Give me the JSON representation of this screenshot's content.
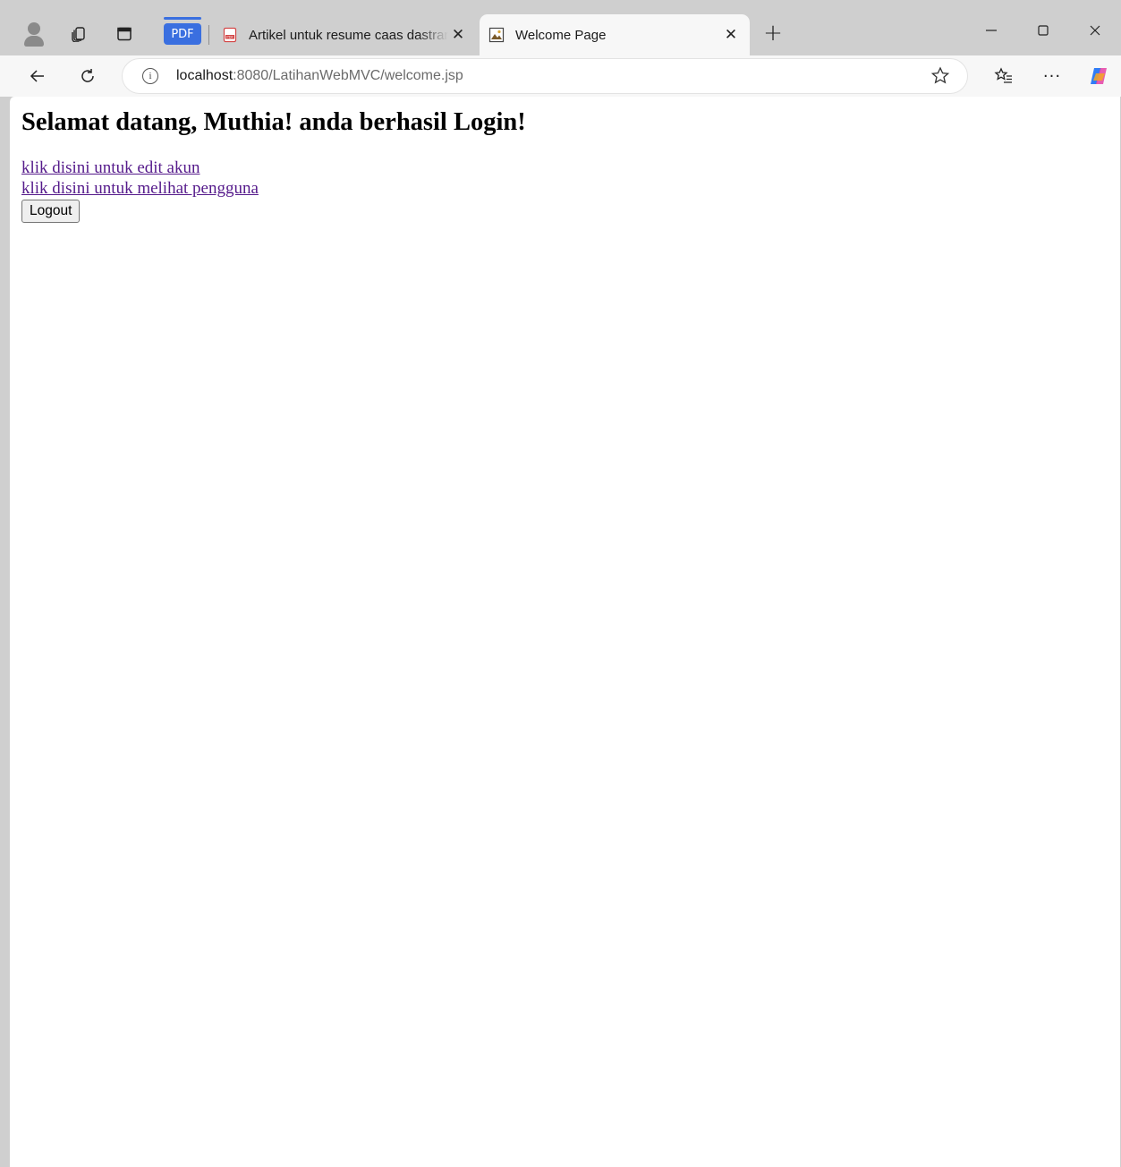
{
  "browser": {
    "tabs": [
      {
        "title": "Artikel untuk resume caas dastrans",
        "active": false,
        "close": "✕"
      },
      {
        "title": "Welcome Page",
        "active": true,
        "close": "✕"
      }
    ],
    "pdf_badge": "PDF",
    "new_tab": "+",
    "address": {
      "host": "localhost",
      "path": ":8080/LatihanWebMVC/welcome.jsp"
    },
    "more_label": "···",
    "icons": [
      "profile-icon",
      "collections-icon",
      "vertical-tabs-icon",
      "pdf-icon",
      "image-icon",
      "back-icon",
      "reload-icon",
      "info-icon",
      "star-icon",
      "favorites-icon",
      "more-icon",
      "copilot-icon",
      "minimize-icon",
      "maximize-icon",
      "close-icon"
    ]
  },
  "page": {
    "heading": "Selamat datang, Muthia! anda berhasil Login!",
    "links": [
      "klik disini untuk edit akun",
      "klik disini untuk melihat pengguna"
    ],
    "logout_label": "Logout",
    "link_color": "#551a8b"
  }
}
